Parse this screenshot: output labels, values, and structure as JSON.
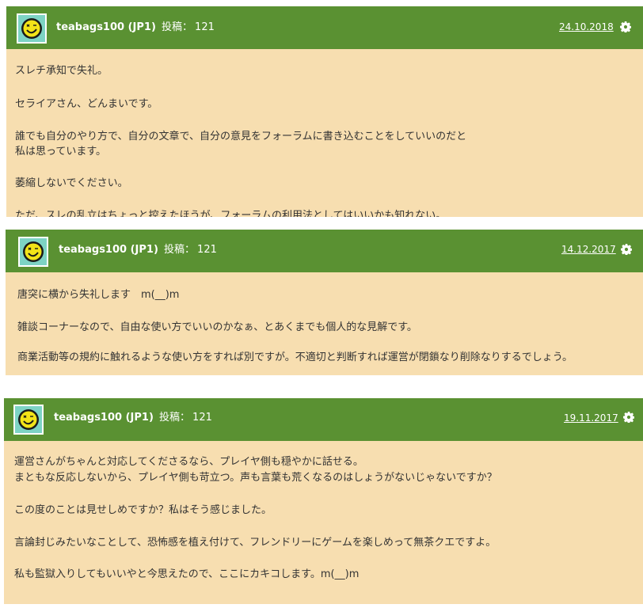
{
  "posts": [
    {
      "author": "teabags100 (JP1)",
      "posts_label": "投稿：",
      "post_count": "121",
      "date": "24.10.2018",
      "lines": [
        "スレチ承知で失礼。",
        "セライアさん、どんまいです。",
        "誰でも自分のやり方で、自分の文章で、自分の意見をフォーラムに書き込むことをしていいのだと",
        "私は思っています。",
        "萎縮しないでください。",
        "ただ、スレの乱立はちょっと控えたほうが、フォーラムの利用法としてはいいかも知れない。"
      ]
    },
    {
      "author": "teabags100 (JP1)",
      "posts_label": "投稿：",
      "post_count": "121",
      "date": "14.12.2017",
      "lines": [
        "唐突に横から失礼します　m(__)m",
        "雑談コーナーなので、自由な使い方でいいのかなぁ、とあくまでも個人的な見解です。",
        "商業活動等の規約に触れるような使い方をすれば別ですが。不適切と判断すれば運営が閉鎖なり削除なりするでしょう。"
      ]
    },
    {
      "author": "teabags100 (JP1)",
      "posts_label": "投稿：",
      "post_count": "121",
      "date": "19.11.2017",
      "lines": [
        "運営さんがちゃんと対応してくださるなら、プレイヤ側も穏やかに話せる。",
        "まともな反応しないから、プレイヤ側も苛立つ。声も言葉も荒くなるのはしょうがないじゃないですか？",
        "この度のことは見せしめですか？私はそう感じました。",
        "言論封じみたいなことして、恐怖感を植え付けて、フレンドリーにゲームを楽しめって無茶クエですよ。",
        "私も監獄入りしてもいいやと今思えたので、ここにカキコします。m(__)m"
      ]
    }
  ],
  "colors": {
    "header_green": "#5a9132",
    "post_background": "#f7deb0",
    "avatar_background": "#7dd3c4"
  },
  "icons": {
    "settings": "gear-icon",
    "avatar": "smiley-face-avatar"
  }
}
